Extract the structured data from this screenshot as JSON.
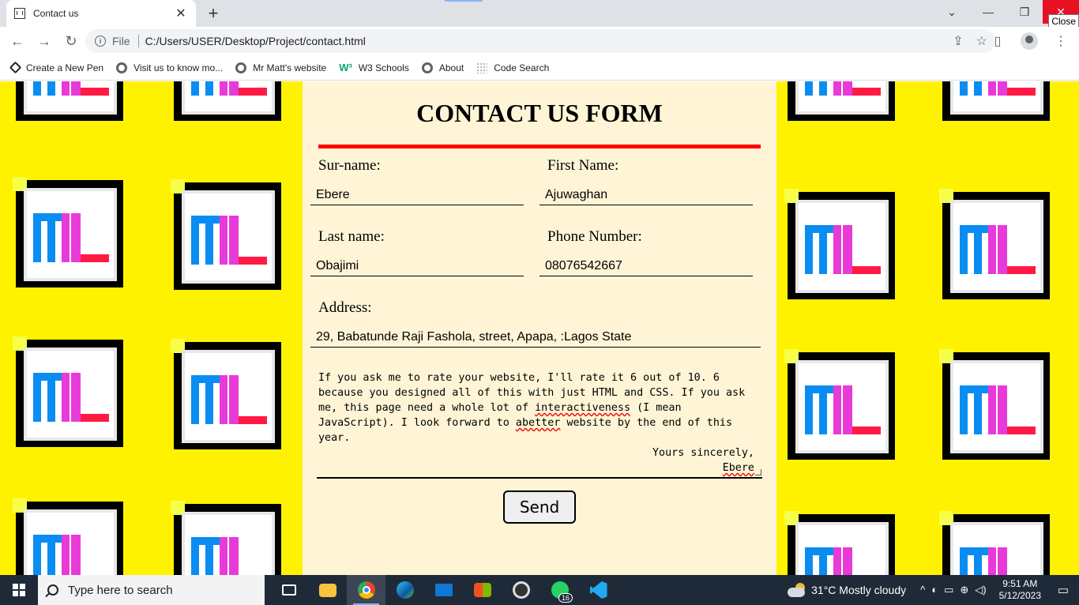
{
  "browser": {
    "tab_title": "Contact us",
    "tab_close": "✕",
    "new_tab": "+",
    "window_minimize": "—",
    "window_restore": "❐",
    "window_close": "✕",
    "close_tooltip": "Close",
    "collapse_tabs": "⌄",
    "back": "←",
    "forward": "→",
    "reload": "↻",
    "address_scheme": "File",
    "address_url": "C:/Users/USER/Desktop/Project/contact.html",
    "share": "⇪",
    "star": "☆",
    "side_panel": "▯",
    "menu": "⋮"
  },
  "bookmarks": [
    {
      "label": "Create a New Pen",
      "icon": "codepen-icon"
    },
    {
      "label": "Visit us to know mo...",
      "icon": "globe-icon"
    },
    {
      "label": "Mr Matt's website",
      "icon": "globe-icon"
    },
    {
      "label": "W3 Schools",
      "icon": "w3schools-icon"
    },
    {
      "label": "About",
      "icon": "globe-icon"
    },
    {
      "label": "Code Search",
      "icon": "dotted-icon"
    }
  ],
  "form": {
    "title": "CONTACT US FORM",
    "surname_label": "Sur-name:",
    "surname_value": "Ebere",
    "firstname_label": "First Name:",
    "firstname_value": "Ajuwaghan",
    "lastname_label": "Last name:",
    "lastname_value": "Obajimi",
    "phone_label": "Phone Number:",
    "phone_value": "08076542667",
    "address_label": "Address:",
    "address_value": "29, Babatunde Raji Fashola, street, Apapa, :Lagos State",
    "message_part1": "If you ask me to rate your website, I'll rate it 6 out of 10. 6 because you designed all of this with just HTML and CSS. If you ask me, this page need a whole lot of ",
    "message_misspelled1": "interactiveness",
    "message_part2": " (I mean JavaScript). I look forward to ",
    "message_misspelled2": "abetter",
    "message_part3": " website by the end of this year.",
    "message_closing": "Yours sincerely,",
    "message_signature": "Ebere",
    "send_label": "Send"
  },
  "colors": {
    "background_yellow": "#fff200",
    "panel_cream": "#fff5d6",
    "rule_red": "#ff0000",
    "logo_blue": "#0a8df2",
    "logo_magenta": "#e83ad8",
    "logo_red": "#ff1a44"
  },
  "taskbar": {
    "search_placeholder": "Type here to search",
    "whatsapp_badge": "16",
    "weather": "31°C  Mostly cloudy",
    "time": "9:51 AM",
    "date": "5/12/2023",
    "tray_chevron": "^"
  }
}
